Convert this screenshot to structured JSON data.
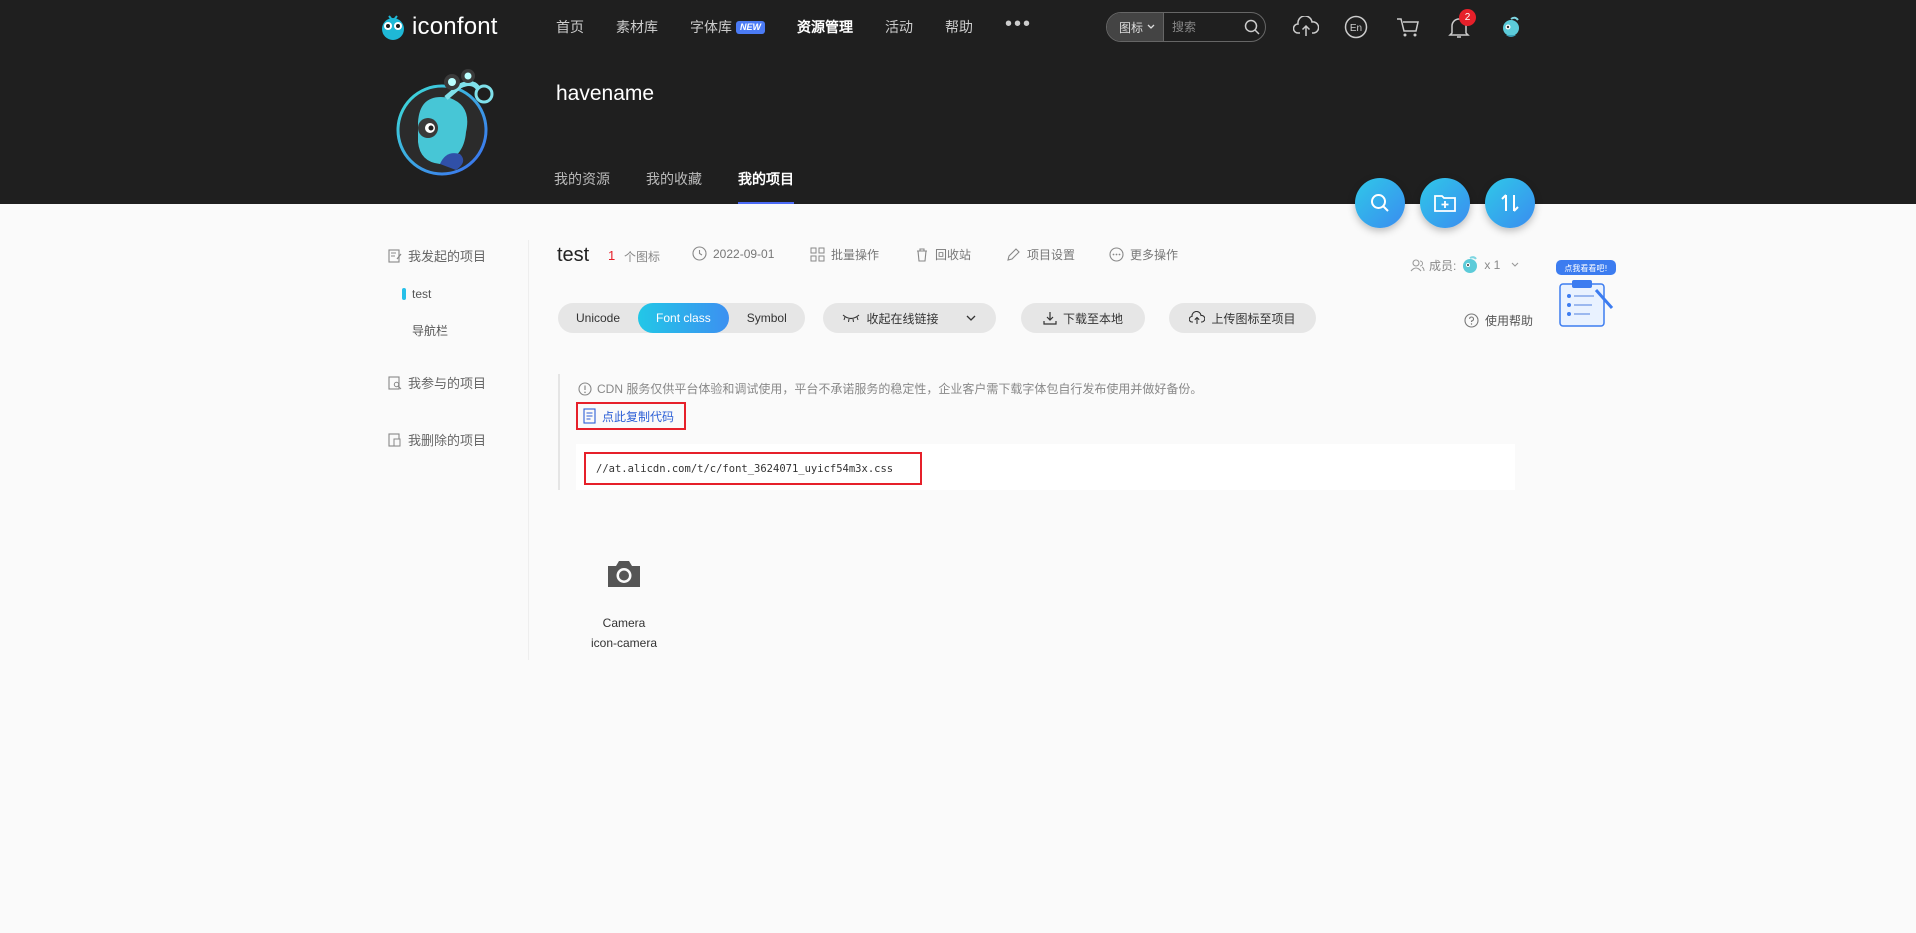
{
  "header": {
    "logo_text": "iconfont",
    "nav": [
      {
        "label": "首页",
        "active": false
      },
      {
        "label": "素材库",
        "active": false
      },
      {
        "label": "字体库",
        "active": false,
        "badge": "NEW"
      },
      {
        "label": "资源管理",
        "active": true
      },
      {
        "label": "活动",
        "active": false
      },
      {
        "label": "帮助",
        "active": false
      }
    ],
    "more": "•••",
    "search": {
      "type": "图标",
      "placeholder": "搜索"
    },
    "notifications": "2"
  },
  "profile": {
    "username": "havename",
    "tabs": [
      "我的资源",
      "我的收藏",
      "我的项目"
    ],
    "active_tab": "我的项目"
  },
  "sidebar": {
    "initiated": "我发起的项目",
    "initiated_items": [
      "test",
      "导航栏"
    ],
    "joined": "我参与的项目",
    "deleted": "我删除的项目"
  },
  "project": {
    "title": "test",
    "icon_count": "1",
    "icon_count_label": "个图标",
    "date": "2022-09-01",
    "actions": [
      "批量操作",
      "回收站",
      "项目设置",
      "更多操作"
    ],
    "members_label": "成员:",
    "members_count": "x 1",
    "formats": [
      "Unicode",
      "Font class",
      "Symbol"
    ],
    "active_format": "Font class",
    "collapse_link": "收起在线链接",
    "download": "下载至本地",
    "upload": "上传图标至项目",
    "help": "使用帮助"
  },
  "cdn": {
    "notice": "CDN 服务仅供平台体验和调试使用，平台不承诺服务的稳定性，企业客户需下载字体包自行发布使用并做好备份。",
    "copy_label": "点此复制代码",
    "url": "//at.alicdn.com/t/c/font_3624071_uyicf54m3x.css"
  },
  "promo": {
    "label": "点我看看吧!"
  },
  "icons": [
    {
      "name": "Camera",
      "class": "icon-camera",
      "icon": "camera-icon"
    }
  ],
  "colors": {
    "header_bg": "#1f1f1f",
    "accent_gradient_start": "#22c7e7",
    "accent_gradient_end": "#3c90f1",
    "highlight_red": "#e6202a",
    "link_blue": "#2c5fd6"
  }
}
